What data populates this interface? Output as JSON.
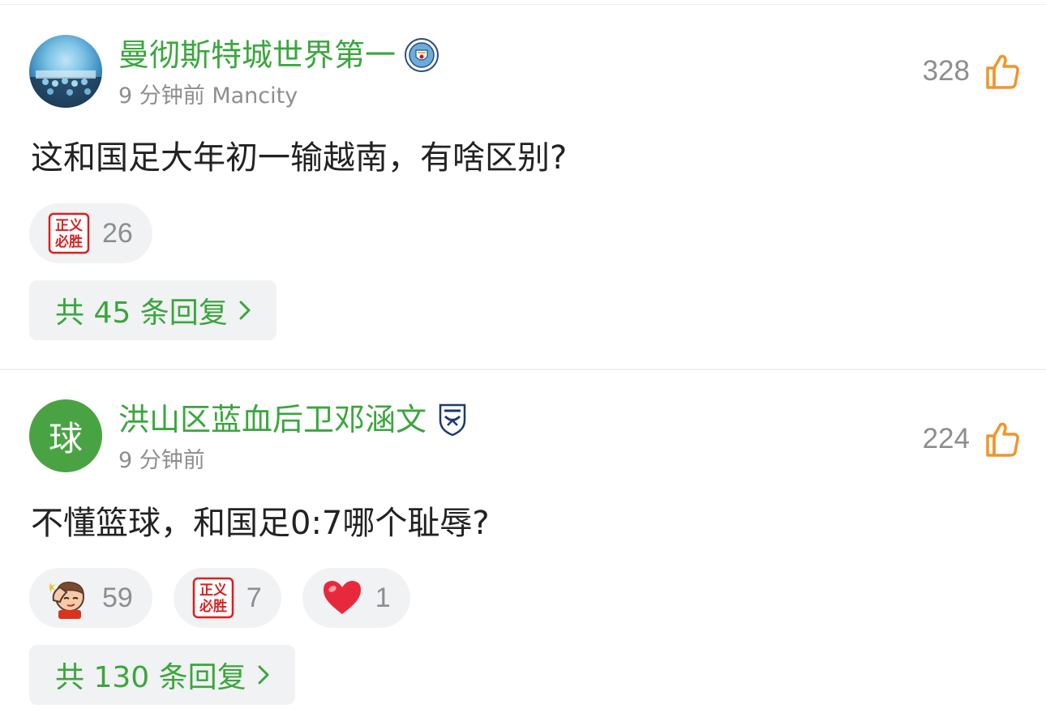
{
  "comments": [
    {
      "username": "曼彻斯特城世界第一",
      "time": "9 分钟前 Mancity",
      "likes": "328",
      "text": "这和国足大年初一输越南，有啥区别?",
      "reactions": [
        {
          "icon": "zhengyi-bisheng-sticker-icon",
          "count": "26"
        }
      ],
      "replies": "共 45 条回复"
    },
    {
      "username": "洪山区蓝血后卫邓涵文",
      "avatar_text": "球",
      "time": "9 分钟前",
      "likes": "224",
      "text": "不懂篮球，和国足0:7哪个耻辱?",
      "reactions": [
        {
          "icon": "facepalm-guy-sticker-icon",
          "count": "59"
        },
        {
          "icon": "zhengyi-bisheng-sticker-icon",
          "count": "7"
        },
        {
          "icon": "heart-icon",
          "count": "1"
        }
      ],
      "replies": "共 130 条回复"
    }
  ],
  "colors": {
    "username_green": "#3aa63d",
    "meta_gray": "#8e8e8e",
    "pill_bg": "#f1f2f3",
    "like_orange": "#f0952a",
    "avatar_green": "#4aa343"
  },
  "stickers": {
    "zhengyi_line1": "正义",
    "zhengyi_line2": "必胜"
  }
}
